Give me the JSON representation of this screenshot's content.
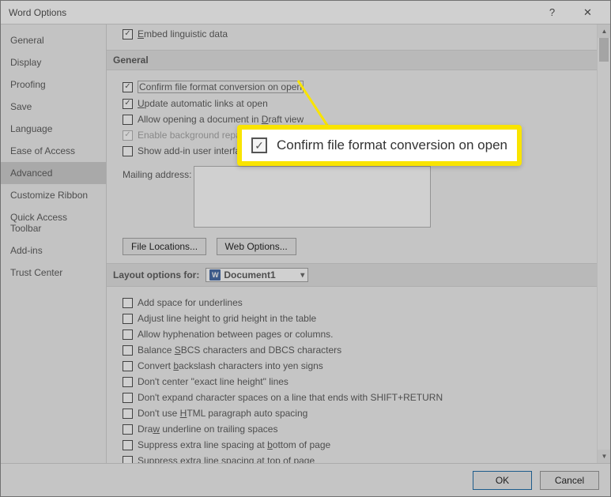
{
  "titlebar": {
    "title": "Word Options",
    "help": "?",
    "close": "✕"
  },
  "sidebar": {
    "items": [
      {
        "label": "General"
      },
      {
        "label": "Display"
      },
      {
        "label": "Proofing"
      },
      {
        "label": "Save"
      },
      {
        "label": "Language"
      },
      {
        "label": "Ease of Access"
      },
      {
        "label": "Advanced",
        "selected": true
      },
      {
        "label": "Customize Ribbon"
      },
      {
        "label": "Quick Access Toolbar"
      },
      {
        "label": "Add-ins"
      },
      {
        "label": "Trust Center"
      }
    ]
  },
  "top_clip": {
    "label_prefix": "E",
    "label_rest": "mbed linguistic data"
  },
  "section_general": "General",
  "general_opts": {
    "confirm_conv": "Confirm file format conversion on open",
    "update_links_u": "U",
    "update_links_rest": "pdate automatic links at open",
    "allow_draft_pre": "Allow opening a document in ",
    "allow_draft_u": "D",
    "allow_draft_post": "raft view",
    "enable_bg": "Enable background repagination",
    "addin_pre": "Show add-in user inter",
    "addin_rest": "face errors",
    "mailing_pre": "Mailing ",
    "mailing_u": "a",
    "mailing_post": "ddress:"
  },
  "buttons": {
    "file_loc_u": "F",
    "file_loc_rest": "ile Locations...",
    "web_opt_pre": "We",
    "web_opt_u": "b",
    "web_opt_post": " Options..."
  },
  "section_layout": "Layout options for:",
  "doc_selected": "Document1",
  "layout_opts": [
    "Add space for underlines",
    "Adjust line height to grid height in the table",
    "Allow hyphenation between pages or columns.",
    "Balance SBCS characters and DBCS characters",
    "Convert backslash characters into yen signs",
    "Don't center \"exact line height\" lines",
    "Don't expand character spaces on a line that ends with SHIFT+RETURN",
    "Don't use HTML paragraph auto spacing",
    "Draw underline on trailing spaces",
    "Suppress extra line spacing at bottom of page",
    "Suppress extra line spacing at top of page"
  ],
  "layout_underline": {
    "3": {
      "pre": "Balance ",
      "u": "S",
      "post": "BCS characters and DBCS characters"
    },
    "4": {
      "pre": "Convert ",
      "u": "b",
      "post": "ackslash characters into yen signs"
    },
    "7": {
      "pre": "Don't use ",
      "u": "H",
      "post": "TML paragraph auto spacing"
    },
    "8": {
      "pre": "Dra",
      "u": "w",
      "post": " underline on trailing spaces"
    },
    "9": {
      "pre": "Suppress extra line spacing at ",
      "u": "b",
      "post": "ottom of page"
    },
    "10": {
      "pre": "Suppress extra line spacing at ",
      "u": "t",
      "post": "op of page"
    }
  },
  "footer": {
    "ok": "OK",
    "cancel": "Cancel"
  },
  "callout": {
    "text": "Confirm file format conversion on open"
  }
}
